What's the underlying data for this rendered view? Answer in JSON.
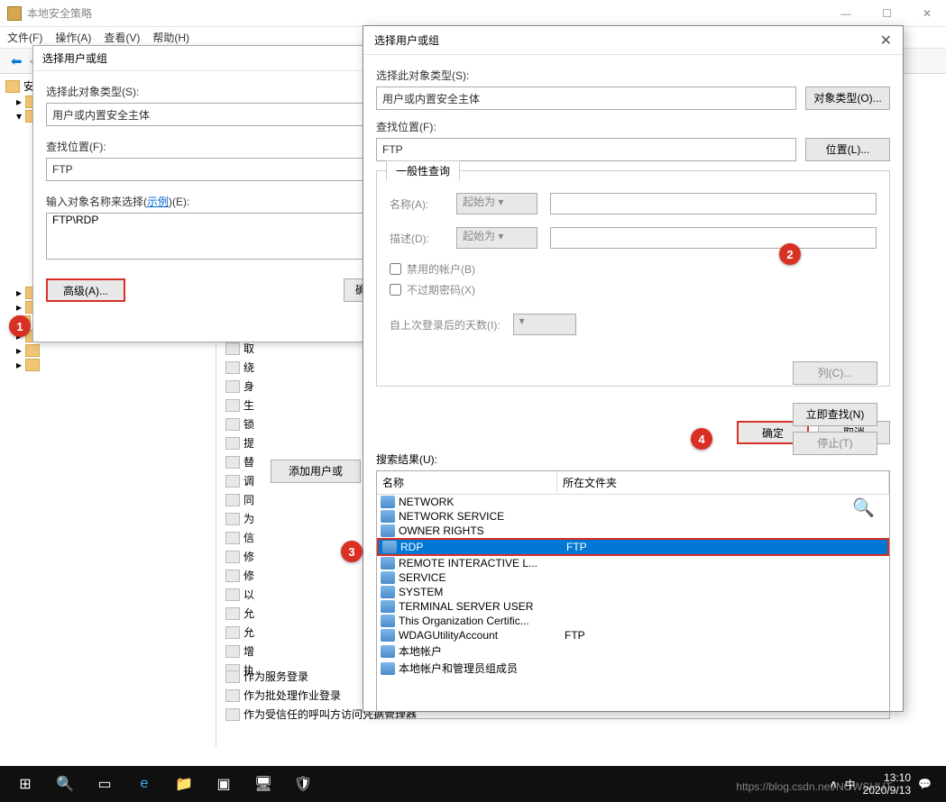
{
  "window": {
    "title": "本地安全策略",
    "menu": {
      "file": "文件(F)",
      "action": "操作(A)",
      "view": "查看(V)",
      "help": "帮助(H)"
    },
    "winbtns": {
      "min": "—",
      "max": "☐",
      "close": "✕"
    }
  },
  "dialog1": {
    "title": "选择用户或组",
    "obj_label": "选择此对象类型(S):",
    "obj_value": "用户或内置安全主体",
    "loc_label": "查找位置(F):",
    "loc_value": "FTP",
    "name_label_pre": "输入对象名称来选择(",
    "name_label_link": "示例",
    "name_label_post": ")(E):",
    "name_value": "FTP\\RDP",
    "advanced_btn": "高级(A)...",
    "ok_partial": "确"
  },
  "dialog2": {
    "title": "选择用户或组",
    "obj_label": "选择此对象类型(S):",
    "obj_value": "用户或内置安全主体",
    "objtype_btn": "对象类型(O)...",
    "loc_label": "查找位置(F):",
    "loc_value": "FTP",
    "loc_btn": "位置(L)...",
    "tab_label": "一般性查询",
    "name_lbl": "名称(A):",
    "desc_lbl": "描述(D):",
    "starts_with": "起始为",
    "chk_disabled": "禁用的帐户(B)",
    "chk_pwd": "不过期密码(X)",
    "days_lbl": "自上次登录后的天数(I):",
    "col_btn": "列(C)...",
    "find_btn": "立即查找(N)",
    "stop_btn": "停止(T)",
    "ok_btn": "确定",
    "cancel_btn": "取消",
    "results_lbl": "搜索结果(U):",
    "col_name": "名称",
    "col_folder": "所在文件夹",
    "results": [
      {
        "name": "NETWORK",
        "folder": ""
      },
      {
        "name": "NETWORK SERVICE",
        "folder": ""
      },
      {
        "name": "OWNER RIGHTS",
        "folder": ""
      },
      {
        "name": "RDP",
        "folder": "FTP",
        "selected": true
      },
      {
        "name": "REMOTE INTERACTIVE L...",
        "folder": ""
      },
      {
        "name": "SERVICE",
        "folder": ""
      },
      {
        "name": "SYSTEM",
        "folder": ""
      },
      {
        "name": "TERMINAL SERVER USER",
        "folder": ""
      },
      {
        "name": "This Organization Certific...",
        "folder": ""
      },
      {
        "name": "WDAGUtilityAccount",
        "folder": "FTP"
      },
      {
        "name": "本地帐户",
        "folder": ""
      },
      {
        "name": "本地帐户和管理员组成员",
        "folder": ""
      }
    ]
  },
  "policy_items": [
    "取",
    "绕",
    "身",
    "生",
    "锁",
    "提",
    "替",
    "调",
    "同",
    "为",
    "信",
    "修",
    "修",
    "以",
    "允",
    "允",
    "增",
    "执"
  ],
  "policy_bottom": [
    "作为服务登录",
    "作为批处理作业登录",
    "作为受信任的呼叫方访问凭据管理器"
  ],
  "adduser_btn": "添加用户或",
  "annotations": {
    "a1": "1",
    "a2": "2",
    "a3": "3",
    "a4": "4"
  },
  "taskbar": {
    "time": "13:10",
    "date": "2020/9/13",
    "watermark": "https://blog.csdn.net/NOWSHUT"
  }
}
